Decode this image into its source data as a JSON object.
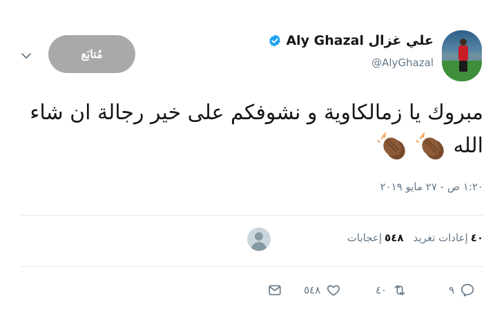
{
  "header": {
    "display_name": "Aly Ghazal علي غزال",
    "handle": "@AlyGhazal",
    "follow_label": "مُتابَع"
  },
  "tweet": {
    "text": "مبروك يا زمالكاوية و نشوفكم على خير رجالة ان شاء الله",
    "emoji": [
      "clapping-hands-dark",
      "clapping-hands-dark"
    ],
    "timestamp": "١:٢٠ ص - ٢٧ مايو ٢٠١٩"
  },
  "stats": {
    "retweets_count": "٤٠",
    "retweets_label": "إعادات تغريد",
    "likes_count": "٥٤٨",
    "likes_label": "إعجابات"
  },
  "actions": {
    "reply_count": "٩",
    "retweet_count": "٤٠",
    "like_count": "٥٤٨"
  },
  "colors": {
    "verified": "#1da1f2",
    "follow_button": "#a9a9a9",
    "secondary_text": "#657786",
    "divider": "#e1e8ed"
  }
}
